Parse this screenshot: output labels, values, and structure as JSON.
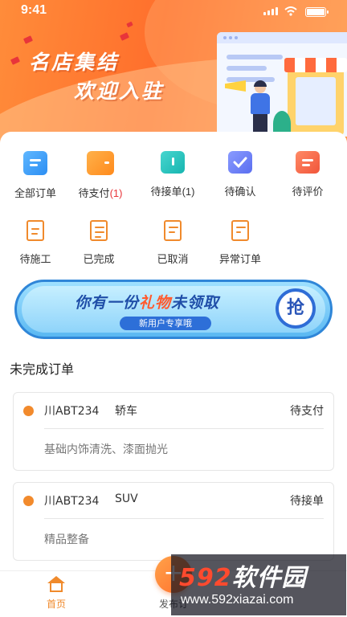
{
  "status": {
    "time": "9:41"
  },
  "hero": {
    "title": "名店集结",
    "subtitle": "欢迎入驻"
  },
  "menu": {
    "row1": [
      {
        "label": "全部订单",
        "count": "",
        "icon": "all-orders-icon"
      },
      {
        "label": "待支付",
        "count": "(1)",
        "icon": "wallet-icon"
      },
      {
        "label": "待接单",
        "count": "(1)",
        "icon": "clock-icon"
      },
      {
        "label": "待确认",
        "count": "",
        "icon": "check-icon"
      },
      {
        "label": "待评价",
        "count": "",
        "icon": "review-icon"
      }
    ],
    "row2": [
      {
        "label": "待施工",
        "icon": "clipboard-wrench-icon"
      },
      {
        "label": "已完成",
        "icon": "document-done-icon"
      },
      {
        "label": "已取消",
        "icon": "document-cancel-icon"
      },
      {
        "label": "异常订单",
        "icon": "document-alert-icon"
      }
    ]
  },
  "banner": {
    "text_pre": "你有一份",
    "text_hl": "礼物",
    "text_post": "未领取",
    "pill": "新用户专享哦",
    "grab": "抢"
  },
  "section": {
    "title": "未完成订单"
  },
  "orders": [
    {
      "plate": "川ABT234",
      "type": "轿车",
      "status": "待支付",
      "service": "基础内饰清洗、漆面抛光"
    },
    {
      "plate": "川ABT234",
      "type": "SUV",
      "status": "待接单",
      "service": "精品整备"
    }
  ],
  "tabbar": {
    "home": "首页",
    "publish": "发布订",
    "fab": "+"
  },
  "watermark": {
    "num": "592",
    "brand": "软件园",
    "url": "www.592xiazai.com"
  },
  "colors": {
    "accent": "#f08a2c",
    "alert": "#e8353a",
    "banner_blue": "#2f86d8"
  }
}
